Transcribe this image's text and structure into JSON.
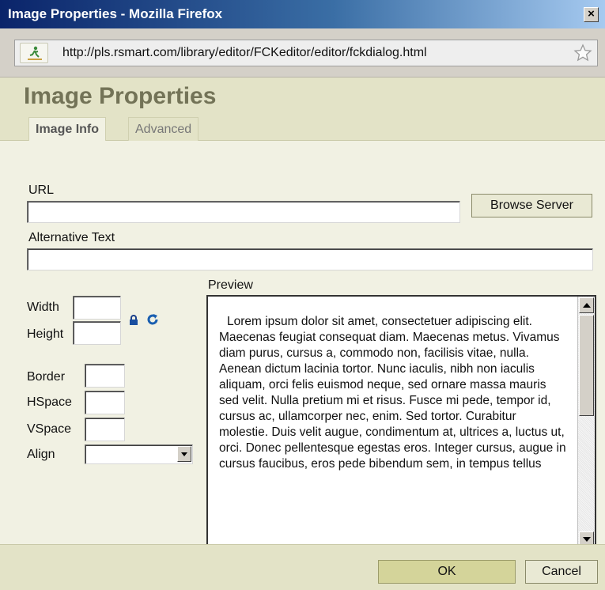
{
  "window": {
    "title": "Image Properties - Mozilla Firefox",
    "close_glyph": "×"
  },
  "addressbar": {
    "url": "http://pls.rsmart.com/library/editor/FCKeditor/editor/fckdialog.html",
    "site_icon": "site-identity-icon",
    "bookmark_icon": "star-icon"
  },
  "dialog": {
    "title": "Image Properties",
    "tabs": [
      {
        "label": "Image Info",
        "active": true
      },
      {
        "label": "Advanced",
        "active": false
      }
    ]
  },
  "form": {
    "url_label": "URL",
    "url_value": "",
    "browse_label": "Browse Server",
    "alt_label": "Alternative Text",
    "alt_value": "",
    "width_label": "Width",
    "height_label": "Height",
    "border_label": "Border",
    "hspace_label": "HSpace",
    "vspace_label": "VSpace",
    "align_label": "Align",
    "align_value": "",
    "lock_icon": "lock-icon",
    "reset_icon": "reset-size-icon"
  },
  "preview": {
    "label": "Preview",
    "text": "Lorem ipsum dolor sit amet, consectetuer adipiscing elit. Maecenas feugiat consequat diam. Maecenas metus. Vivamus diam purus, cursus a, commodo non, facilisis vitae, nulla. Aenean dictum lacinia tortor. Nunc iaculis, nibh non iaculis aliquam, orci felis euismod neque, sed ornare massa mauris sed velit. Nulla pretium mi et risus. Fusce mi pede, tempor id, cursus ac, ullamcorper nec, enim. Sed tortor. Curabitur molestie. Duis velit augue, condimentum at, ultrices a, luctus ut, orci. Donec pellentesque egestas eros. Integer cursus, augue in cursus faucibus, eros pede bibendum sem, in tempus tellus"
  },
  "footer": {
    "ok_label": "OK",
    "cancel_label": "Cancel"
  },
  "colors": {
    "dialog_bg": "#f1f1e3",
    "header_bg": "#e3e3c7",
    "title_text": "#737357",
    "ok_button": "#d4d49a"
  }
}
